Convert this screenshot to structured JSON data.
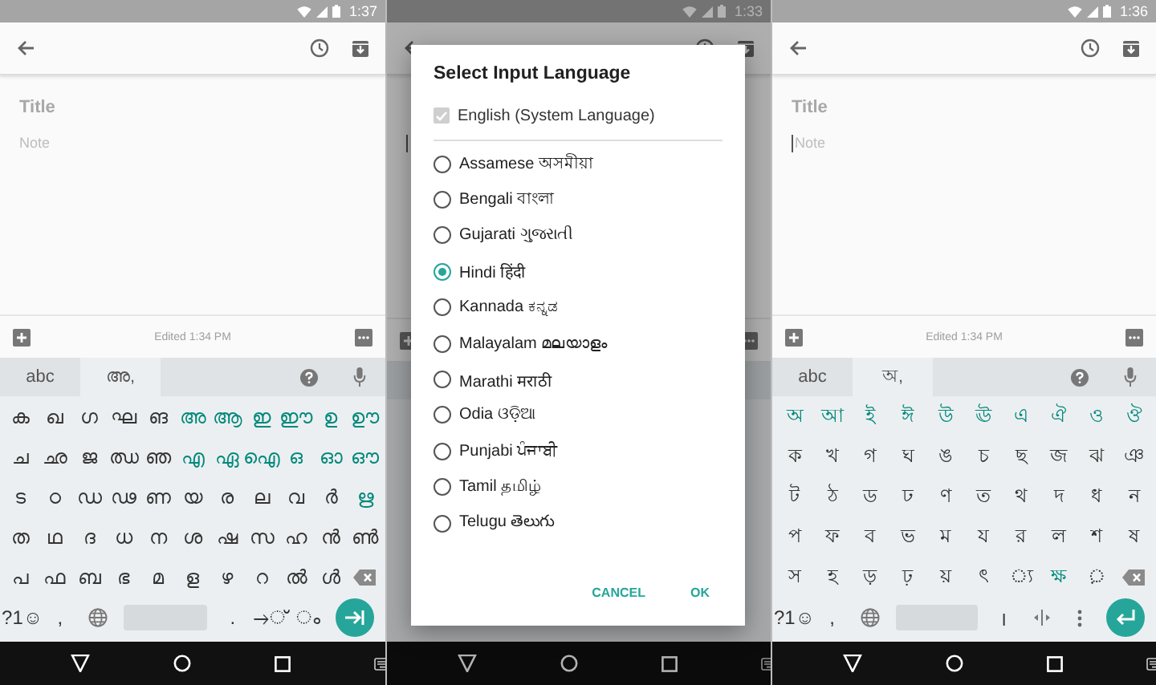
{
  "phones": [
    {
      "status_time": "1:37",
      "title": "Title",
      "note": "Note",
      "cursor": false,
      "dimmed": false,
      "edited": "Edited 1:34 PM",
      "keyboard": {
        "tabs": [
          {
            "label": "abc",
            "selected": false
          },
          {
            "label": "അ,",
            "selected": true
          }
        ],
        "rows": [
          [
            {
              "kind": "char",
              "label": "ക",
              "accent": false
            },
            {
              "kind": "char",
              "label": "ഖ",
              "accent": false
            },
            {
              "kind": "char",
              "label": "ഗ",
              "accent": false
            },
            {
              "kind": "char",
              "label": "ഘ",
              "accent": false
            },
            {
              "kind": "char",
              "label": "ങ",
              "accent": false
            },
            {
              "kind": "char",
              "label": "അ",
              "accent": true
            },
            {
              "kind": "char",
              "label": "ആ",
              "accent": true
            },
            {
              "kind": "char",
              "label": "ഇ",
              "accent": true
            },
            {
              "kind": "char",
              "label": "ഈ",
              "accent": true
            },
            {
              "kind": "char",
              "label": "ഉ",
              "accent": true
            },
            {
              "kind": "char",
              "label": "ഊ",
              "accent": true
            }
          ],
          [
            {
              "kind": "char",
              "label": "ച",
              "accent": false
            },
            {
              "kind": "char",
              "label": "ഛ",
              "accent": false
            },
            {
              "kind": "char",
              "label": "ജ",
              "accent": false
            },
            {
              "kind": "char",
              "label": "ഝ",
              "accent": false
            },
            {
              "kind": "char",
              "label": "ഞ",
              "accent": false
            },
            {
              "kind": "char",
              "label": "എ",
              "accent": true
            },
            {
              "kind": "char",
              "label": "ഏ",
              "accent": true
            },
            {
              "kind": "char",
              "label": "ഐ",
              "accent": true
            },
            {
              "kind": "char",
              "label": "ഒ",
              "accent": true
            },
            {
              "kind": "char",
              "label": "ഓ",
              "accent": true
            },
            {
              "kind": "char",
              "label": "ഔ",
              "accent": true
            }
          ],
          [
            {
              "kind": "char",
              "label": "ട",
              "accent": false
            },
            {
              "kind": "char",
              "label": "ഠ",
              "accent": false
            },
            {
              "kind": "char",
              "label": "ഡ",
              "accent": false
            },
            {
              "kind": "char",
              "label": "ഢ",
              "accent": false
            },
            {
              "kind": "char",
              "label": "ണ",
              "accent": false
            },
            {
              "kind": "char",
              "label": "യ",
              "accent": false
            },
            {
              "kind": "char",
              "label": "ര",
              "accent": false
            },
            {
              "kind": "char",
              "label": "ല",
              "accent": false
            },
            {
              "kind": "char",
              "label": "വ",
              "accent": false
            },
            {
              "kind": "char",
              "label": "ർ",
              "accent": false
            },
            {
              "kind": "char",
              "label": "ഋ",
              "accent": true
            }
          ],
          [
            {
              "kind": "char",
              "label": "ത",
              "accent": false
            },
            {
              "kind": "char",
              "label": "ഥ",
              "accent": false
            },
            {
              "kind": "char",
              "label": "ദ",
              "accent": false
            },
            {
              "kind": "char",
              "label": "ധ",
              "accent": false
            },
            {
              "kind": "char",
              "label": "ന",
              "accent": false
            },
            {
              "kind": "char",
              "label": "ശ",
              "accent": false
            },
            {
              "kind": "char",
              "label": "ഷ",
              "accent": false
            },
            {
              "kind": "char",
              "label": "സ",
              "accent": false
            },
            {
              "kind": "char",
              "label": "ഹ",
              "accent": false
            },
            {
              "kind": "char",
              "label": "ൻ",
              "accent": false
            },
            {
              "kind": "char",
              "label": "ൺ",
              "accent": false
            }
          ],
          [
            {
              "kind": "char",
              "label": "പ",
              "accent": false
            },
            {
              "kind": "char",
              "label": "ഫ",
              "accent": false
            },
            {
              "kind": "char",
              "label": "ബ",
              "accent": false
            },
            {
              "kind": "char",
              "label": "ഭ",
              "accent": false
            },
            {
              "kind": "char",
              "label": "മ",
              "accent": false
            },
            {
              "kind": "char",
              "label": "ള",
              "accent": false
            },
            {
              "kind": "char",
              "label": "ഴ",
              "accent": false
            },
            {
              "kind": "char",
              "label": "റ",
              "accent": false
            },
            {
              "kind": "char",
              "label": "ൽ",
              "accent": false
            },
            {
              "kind": "char",
              "label": "ൾ",
              "accent": false
            },
            {
              "kind": "backspace"
            }
          ]
        ],
        "bottom": [
          {
            "kind": "text",
            "label": "?1☺"
          },
          {
            "kind": "text",
            "label": ","
          },
          {
            "kind": "globe"
          },
          {
            "kind": "space"
          },
          {
            "kind": "text",
            "label": "."
          },
          {
            "kind": "text",
            "label": "→്"
          },
          {
            "kind": "text",
            "label": "◌ം"
          },
          {
            "kind": "next"
          }
        ]
      }
    },
    {
      "status_time": "1:33",
      "cursor": true,
      "dimmed": true
    },
    {
      "status_time": "1:36",
      "title": "Title",
      "note": "Note",
      "cursor": true,
      "dimmed": false,
      "edited": "Edited 1:34 PM",
      "keyboard": {
        "tabs": [
          {
            "label": "abc",
            "selected": false
          },
          {
            "label": "অ,",
            "selected": true
          }
        ],
        "rows": [
          [
            {
              "kind": "char",
              "label": "অ",
              "accent": true
            },
            {
              "kind": "char",
              "label": "আ",
              "accent": true
            },
            {
              "kind": "char",
              "label": "ই",
              "accent": true
            },
            {
              "kind": "char",
              "label": "ঈ",
              "accent": true
            },
            {
              "kind": "char",
              "label": "উ",
              "accent": true
            },
            {
              "kind": "char",
              "label": "ঊ",
              "accent": true
            },
            {
              "kind": "char",
              "label": "এ",
              "accent": true
            },
            {
              "kind": "char",
              "label": "ঐ",
              "accent": true
            },
            {
              "kind": "char",
              "label": "ও",
              "accent": true
            },
            {
              "kind": "char",
              "label": "ঔ",
              "accent": true
            }
          ],
          [
            {
              "kind": "char",
              "label": "ক",
              "accent": false
            },
            {
              "kind": "char",
              "label": "খ",
              "accent": false
            },
            {
              "kind": "char",
              "label": "গ",
              "accent": false
            },
            {
              "kind": "char",
              "label": "ঘ",
              "accent": false
            },
            {
              "kind": "char",
              "label": "ঙ",
              "accent": false
            },
            {
              "kind": "char",
              "label": "চ",
              "accent": false
            },
            {
              "kind": "char",
              "label": "ছ",
              "accent": false
            },
            {
              "kind": "char",
              "label": "জ",
              "accent": false
            },
            {
              "kind": "char",
              "label": "ঝ",
              "accent": false
            },
            {
              "kind": "char",
              "label": "ঞ",
              "accent": false
            }
          ],
          [
            {
              "kind": "char",
              "label": "ট",
              "accent": false
            },
            {
              "kind": "char",
              "label": "ঠ",
              "accent": false
            },
            {
              "kind": "char",
              "label": "ড",
              "accent": false
            },
            {
              "kind": "char",
              "label": "ঢ",
              "accent": false
            },
            {
              "kind": "char",
              "label": "ণ",
              "accent": false
            },
            {
              "kind": "char",
              "label": "ত",
              "accent": false
            },
            {
              "kind": "char",
              "label": "থ",
              "accent": false
            },
            {
              "kind": "char",
              "label": "দ",
              "accent": false
            },
            {
              "kind": "char",
              "label": "ধ",
              "accent": false
            },
            {
              "kind": "char",
              "label": "ন",
              "accent": false
            }
          ],
          [
            {
              "kind": "char",
              "label": "প",
              "accent": false
            },
            {
              "kind": "char",
              "label": "ফ",
              "accent": false
            },
            {
              "kind": "char",
              "label": "ব",
              "accent": false
            },
            {
              "kind": "char",
              "label": "ভ",
              "accent": false
            },
            {
              "kind": "char",
              "label": "ম",
              "accent": false
            },
            {
              "kind": "char",
              "label": "য",
              "accent": false
            },
            {
              "kind": "char",
              "label": "র",
              "accent": false
            },
            {
              "kind": "char",
              "label": "ল",
              "accent": false
            },
            {
              "kind": "char",
              "label": "শ",
              "accent": false
            },
            {
              "kind": "char",
              "label": "ষ",
              "accent": false
            }
          ],
          [
            {
              "kind": "char",
              "label": "স",
              "accent": false
            },
            {
              "kind": "char",
              "label": "হ",
              "accent": false
            },
            {
              "kind": "char",
              "label": "ড়",
              "accent": false
            },
            {
              "kind": "char",
              "label": "ঢ়",
              "accent": false
            },
            {
              "kind": "char",
              "label": "য়",
              "accent": false
            },
            {
              "kind": "char",
              "label": "ৎ",
              "accent": false
            },
            {
              "kind": "char",
              "label": "◌্য",
              "accent": false
            },
            {
              "kind": "char",
              "label": "ক্ষ",
              "accent": true
            },
            {
              "kind": "char",
              "label": "◌়",
              "accent": false
            },
            {
              "kind": "backspace"
            }
          ]
        ],
        "bottom": [
          {
            "kind": "text",
            "label": "?1☺"
          },
          {
            "kind": "text",
            "label": ","
          },
          {
            "kind": "globe"
          },
          {
            "kind": "space"
          },
          {
            "kind": "text",
            "label": "।"
          },
          {
            "kind": "cursor"
          },
          {
            "kind": "more"
          },
          {
            "kind": "return"
          }
        ]
      }
    }
  ],
  "dialog": {
    "title": "Select Input Language",
    "system_language": {
      "label": "English (System Language)",
      "checked": true,
      "disabled": true
    },
    "languages": [
      {
        "label": "Assamese অসমীয়া",
        "selected": false
      },
      {
        "label": "Bengali বাংলা",
        "selected": false
      },
      {
        "label": "Gujarati ગુજરાતી",
        "selected": false
      },
      {
        "label": "Hindi हिंदी",
        "selected": true
      },
      {
        "label": "Kannada ಕನ್ನಡ",
        "selected": false
      },
      {
        "label": "Malayalam മലയാളം",
        "selected": false
      },
      {
        "label": "Marathi मराठी",
        "selected": false
      },
      {
        "label": "Odia ଓଡ଼ିଆ",
        "selected": false
      },
      {
        "label": "Punjabi ਪੰਜਾਬੀ",
        "selected": false
      },
      {
        "label": "Tamil தமிழ்",
        "selected": false
      },
      {
        "label": "Telugu తెలుగు",
        "selected": false
      }
    ],
    "buttons": [
      "CANCEL",
      "OK"
    ]
  }
}
